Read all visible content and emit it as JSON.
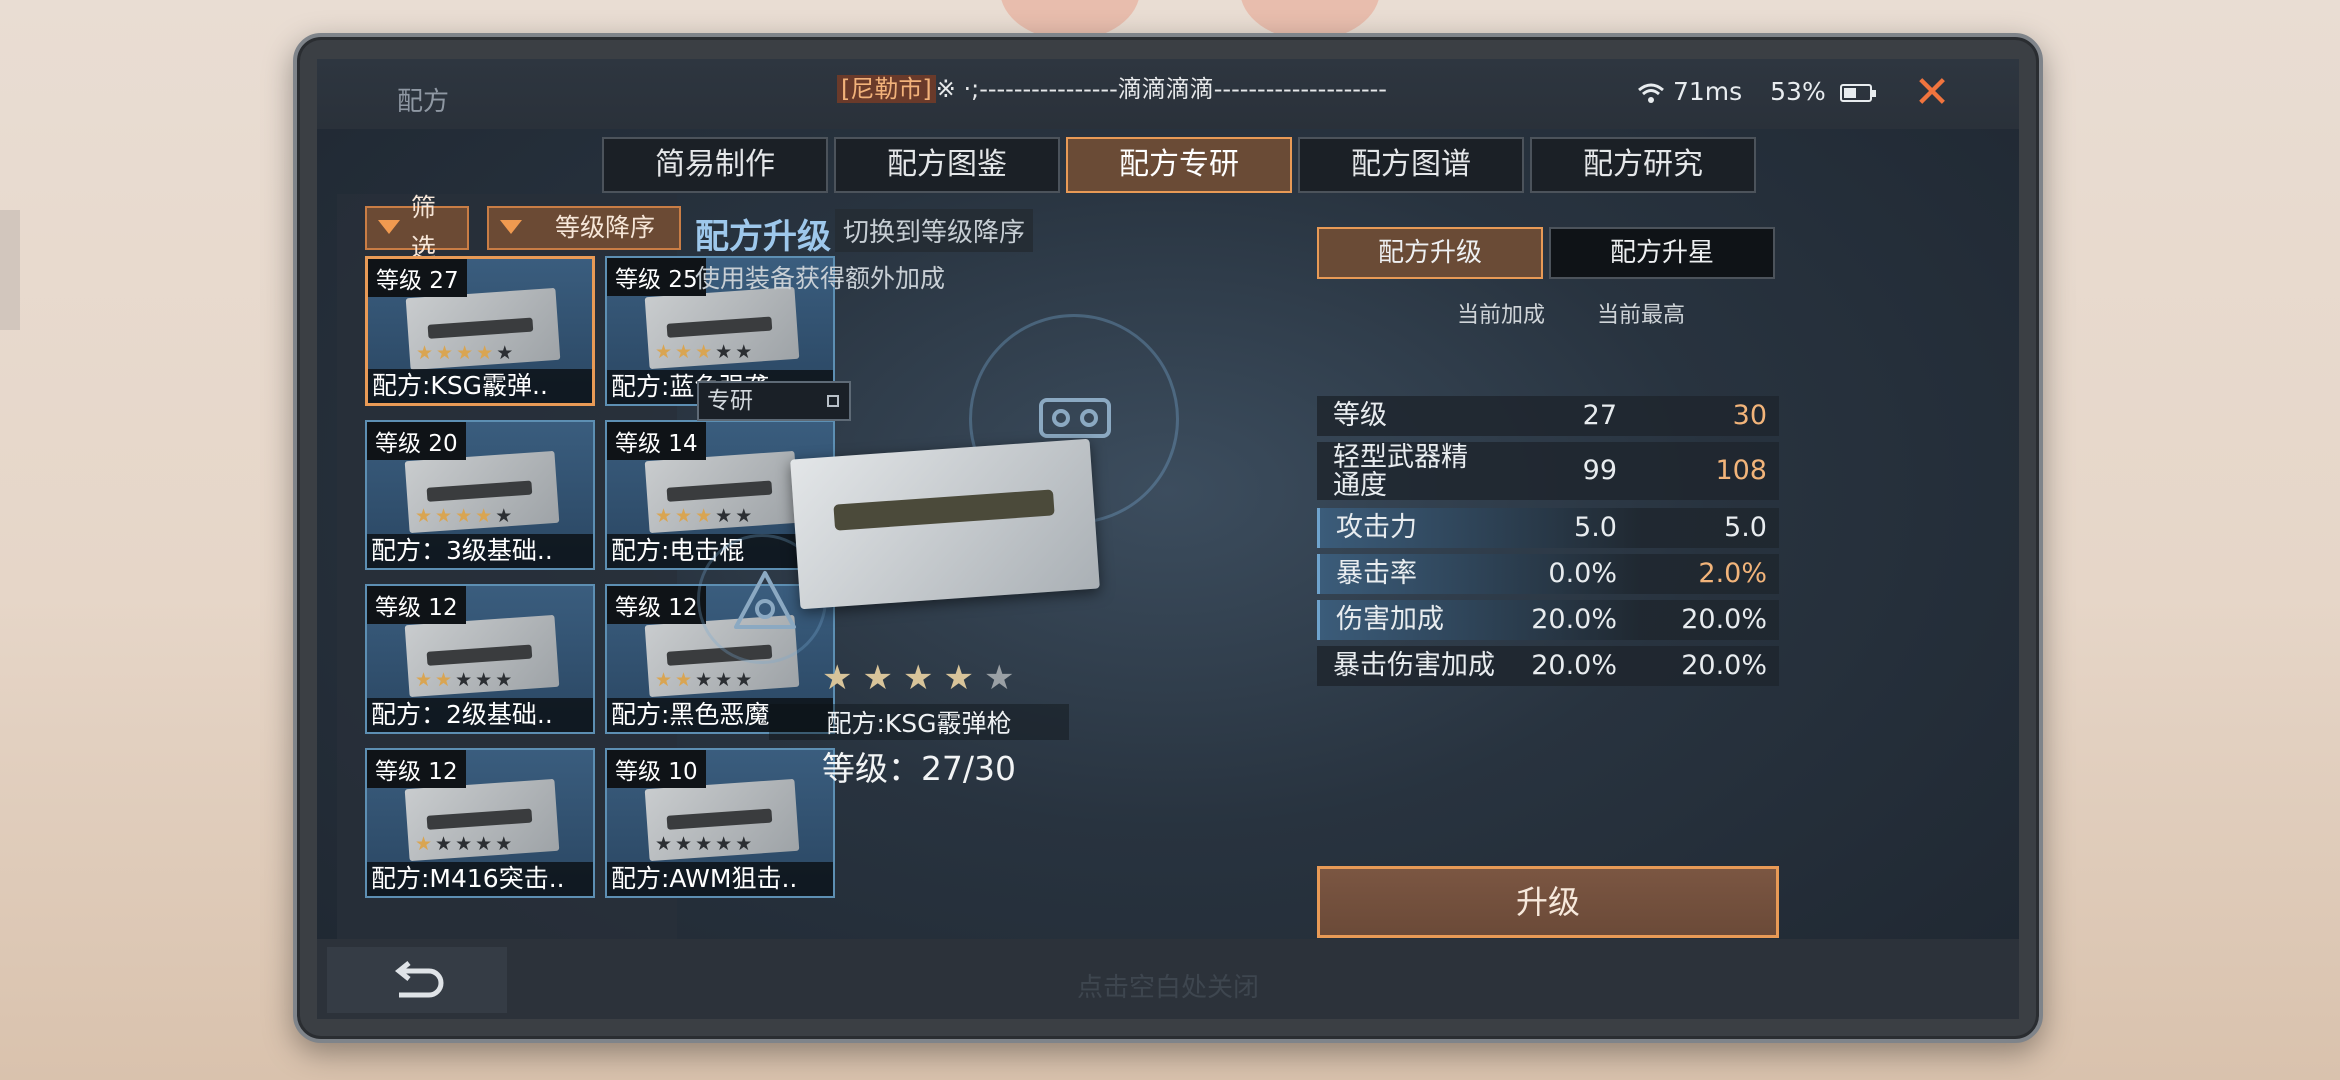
{
  "window": {
    "title": "配方",
    "marquee_tag": "[尼勒市]",
    "marquee_text": "※ ·;----------------滴滴滴滴--------------------",
    "ping": "71ms",
    "battery": "53%",
    "battery_level": 0.53,
    "close_symbol": "✕"
  },
  "tabs": [
    {
      "label": "简易制作"
    },
    {
      "label": "配方图鉴"
    },
    {
      "label": "配方专研",
      "active": true
    },
    {
      "label": "配方图谱"
    },
    {
      "label": "配方研究"
    }
  ],
  "filters": {
    "filter_label": "筛选",
    "sort_label": "等级降序"
  },
  "recipes": [
    {
      "level": "等级 27",
      "name": "配方:KSG霰弹..",
      "stars": 4,
      "max_stars": 5
    },
    {
      "level": "等级 25",
      "name": "配方:蓝色强袭..",
      "stars": 3,
      "max_stars": 5
    },
    {
      "level": "等级 20",
      "name": "配方：3级基础..",
      "stars": 4,
      "max_stars": 5
    },
    {
      "level": "等级 14",
      "name": "配方:电击棍",
      "stars": 3,
      "max_stars": 5
    },
    {
      "level": "等级 12",
      "name": "配方：2级基础..",
      "stars": 2,
      "max_stars": 5
    },
    {
      "level": "等级 12",
      "name": "配方:黑色恶魔",
      "stars": 2,
      "max_stars": 5
    },
    {
      "level": "等级 12",
      "name": "配方:M416突击..",
      "stars": 1,
      "max_stars": 5
    },
    {
      "level": "等级 10",
      "name": "配方:AWM狙击..",
      "stars": 0,
      "max_stars": 5
    }
  ],
  "center": {
    "title": "配方升级",
    "switch_label": "切换到等级降序",
    "subtitle": "使用装备获得额外加成",
    "tag": "专研",
    "item_name": "配方:KSG霰弹枪",
    "level_text": "等级：27/30",
    "stars": 4,
    "max_stars": 5
  },
  "right": {
    "tabs": [
      {
        "label": "配方升级",
        "active": true
      },
      {
        "label": "配方升星"
      }
    ],
    "col_current": "当前加成",
    "col_max": "当前最高",
    "stats": [
      {
        "label": "等级",
        "current": "27",
        "max": "30",
        "max_higher": true
      },
      {
        "label": "轻型武器精通度",
        "current": "99",
        "max": "108",
        "max_higher": true
      },
      {
        "label": "攻击力",
        "current": "5.0",
        "max": "5.0",
        "max_higher": false
      },
      {
        "label": "暴击率",
        "current": "0.0%",
        "max": "2.0%",
        "max_higher": true
      },
      {
        "label": "伤害加成",
        "current": "20.0%",
        "max": "20.0%",
        "max_higher": false
      },
      {
        "label": "暴击伤害加成",
        "current": "20.0%",
        "max": "20.0%",
        "max_higher": false
      }
    ],
    "upgrade_label": "升级"
  },
  "bottom": {
    "hint": "点击空白处关闭"
  },
  "colors": {
    "accent": "#e89a56",
    "highlight_value": "#f2b47a",
    "title_blue": "#9ec8ec"
  }
}
